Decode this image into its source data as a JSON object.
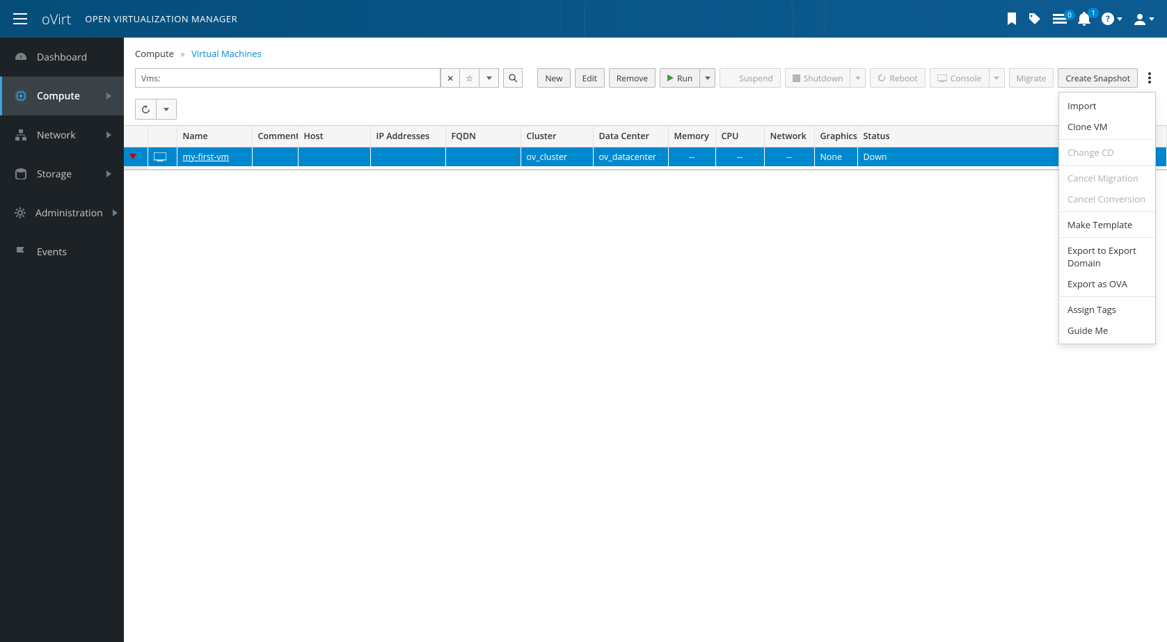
{
  "header": {
    "brand": "oVirt",
    "app_name": "OPEN VIRTUALIZATION MANAGER",
    "tasks_badge": "0",
    "alerts_badge": "1"
  },
  "sidebar": {
    "items": [
      {
        "key": "dashboard",
        "label": "Dashboard",
        "has_children": false
      },
      {
        "key": "compute",
        "label": "Compute",
        "has_children": true,
        "active": true
      },
      {
        "key": "network",
        "label": "Network",
        "has_children": true
      },
      {
        "key": "storage",
        "label": "Storage",
        "has_children": true
      },
      {
        "key": "administration",
        "label": "Administration",
        "has_children": true
      },
      {
        "key": "events",
        "label": "Events",
        "has_children": false
      }
    ]
  },
  "breadcrumb": {
    "root": "Compute",
    "leaf": "Virtual Machines"
  },
  "search": {
    "label": "Vms:",
    "value": ""
  },
  "actions": {
    "new": "New",
    "edit": "Edit",
    "remove": "Remove",
    "run": "Run",
    "suspend": "Suspend",
    "shutdown": "Shutdown",
    "reboot": "Reboot",
    "console": "Console",
    "migrate": "Migrate",
    "snapshot": "Create Snapshot"
  },
  "table": {
    "columns": [
      "",
      "",
      "Name",
      "Comment",
      "Host",
      "IP Addresses",
      "FQDN",
      "Cluster",
      "Data Center",
      "Memory",
      "CPU",
      "Network",
      "Graphics",
      "Status"
    ],
    "rows": [
      {
        "name": "my-first-vm",
        "comment": "",
        "host": "",
        "ip": "",
        "fqdn": "",
        "cluster": "ov_cluster",
        "datacenter": "ov_datacenter",
        "memory": "--",
        "cpu": "--",
        "network": "--",
        "graphics": "None",
        "status": "Down"
      }
    ]
  },
  "menu": {
    "items": [
      {
        "label": "Import",
        "enabled": true
      },
      {
        "label": "Clone VM",
        "enabled": true
      },
      {
        "divider": true
      },
      {
        "label": "Change CD",
        "enabled": false
      },
      {
        "divider": true
      },
      {
        "label": "Cancel Migration",
        "enabled": false
      },
      {
        "label": "Cancel Conversion",
        "enabled": false
      },
      {
        "divider": true
      },
      {
        "label": "Make Template",
        "enabled": true
      },
      {
        "divider": true
      },
      {
        "label": "Export to Export Domain",
        "enabled": true
      },
      {
        "label": "Export as OVA",
        "enabled": true
      },
      {
        "divider": true
      },
      {
        "label": "Assign Tags",
        "enabled": true
      },
      {
        "label": "Guide Me",
        "enabled": true
      }
    ]
  }
}
